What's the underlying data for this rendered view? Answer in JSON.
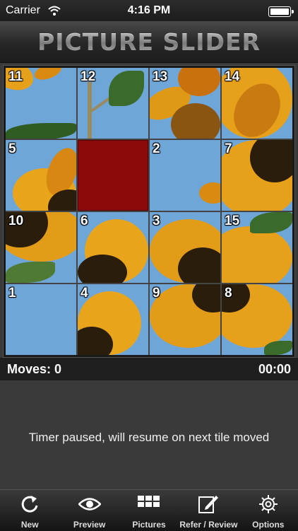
{
  "status_bar": {
    "carrier": "Carrier",
    "time": "4:16 PM"
  },
  "header": {
    "title": "PICTURE SLIDER"
  },
  "board": {
    "tiles": [
      "11",
      "12",
      "13",
      "14",
      "5",
      "",
      "2",
      "7",
      "10",
      "6",
      "3",
      "15",
      "1",
      "4",
      "9",
      "8"
    ],
    "empty_color": "#8b0b0b"
  },
  "info": {
    "moves_label": "Moves: 0",
    "timer": "00:00"
  },
  "message": "Timer paused, will resume on next tile moved",
  "tabs": [
    {
      "label": "New",
      "icon": "refresh-icon"
    },
    {
      "label": "Preview",
      "icon": "eye-icon"
    },
    {
      "label": "Pictures",
      "icon": "grid-icon"
    },
    {
      "label": "Refer / Review",
      "icon": "pencil-note-icon"
    },
    {
      "label": "Options",
      "icon": "gear-icon"
    }
  ],
  "colors": {
    "sky": "#6fa6d8",
    "petal": "#e9a21a",
    "center": "#2b1d0c",
    "empty_tile": "#8b0b0b"
  }
}
